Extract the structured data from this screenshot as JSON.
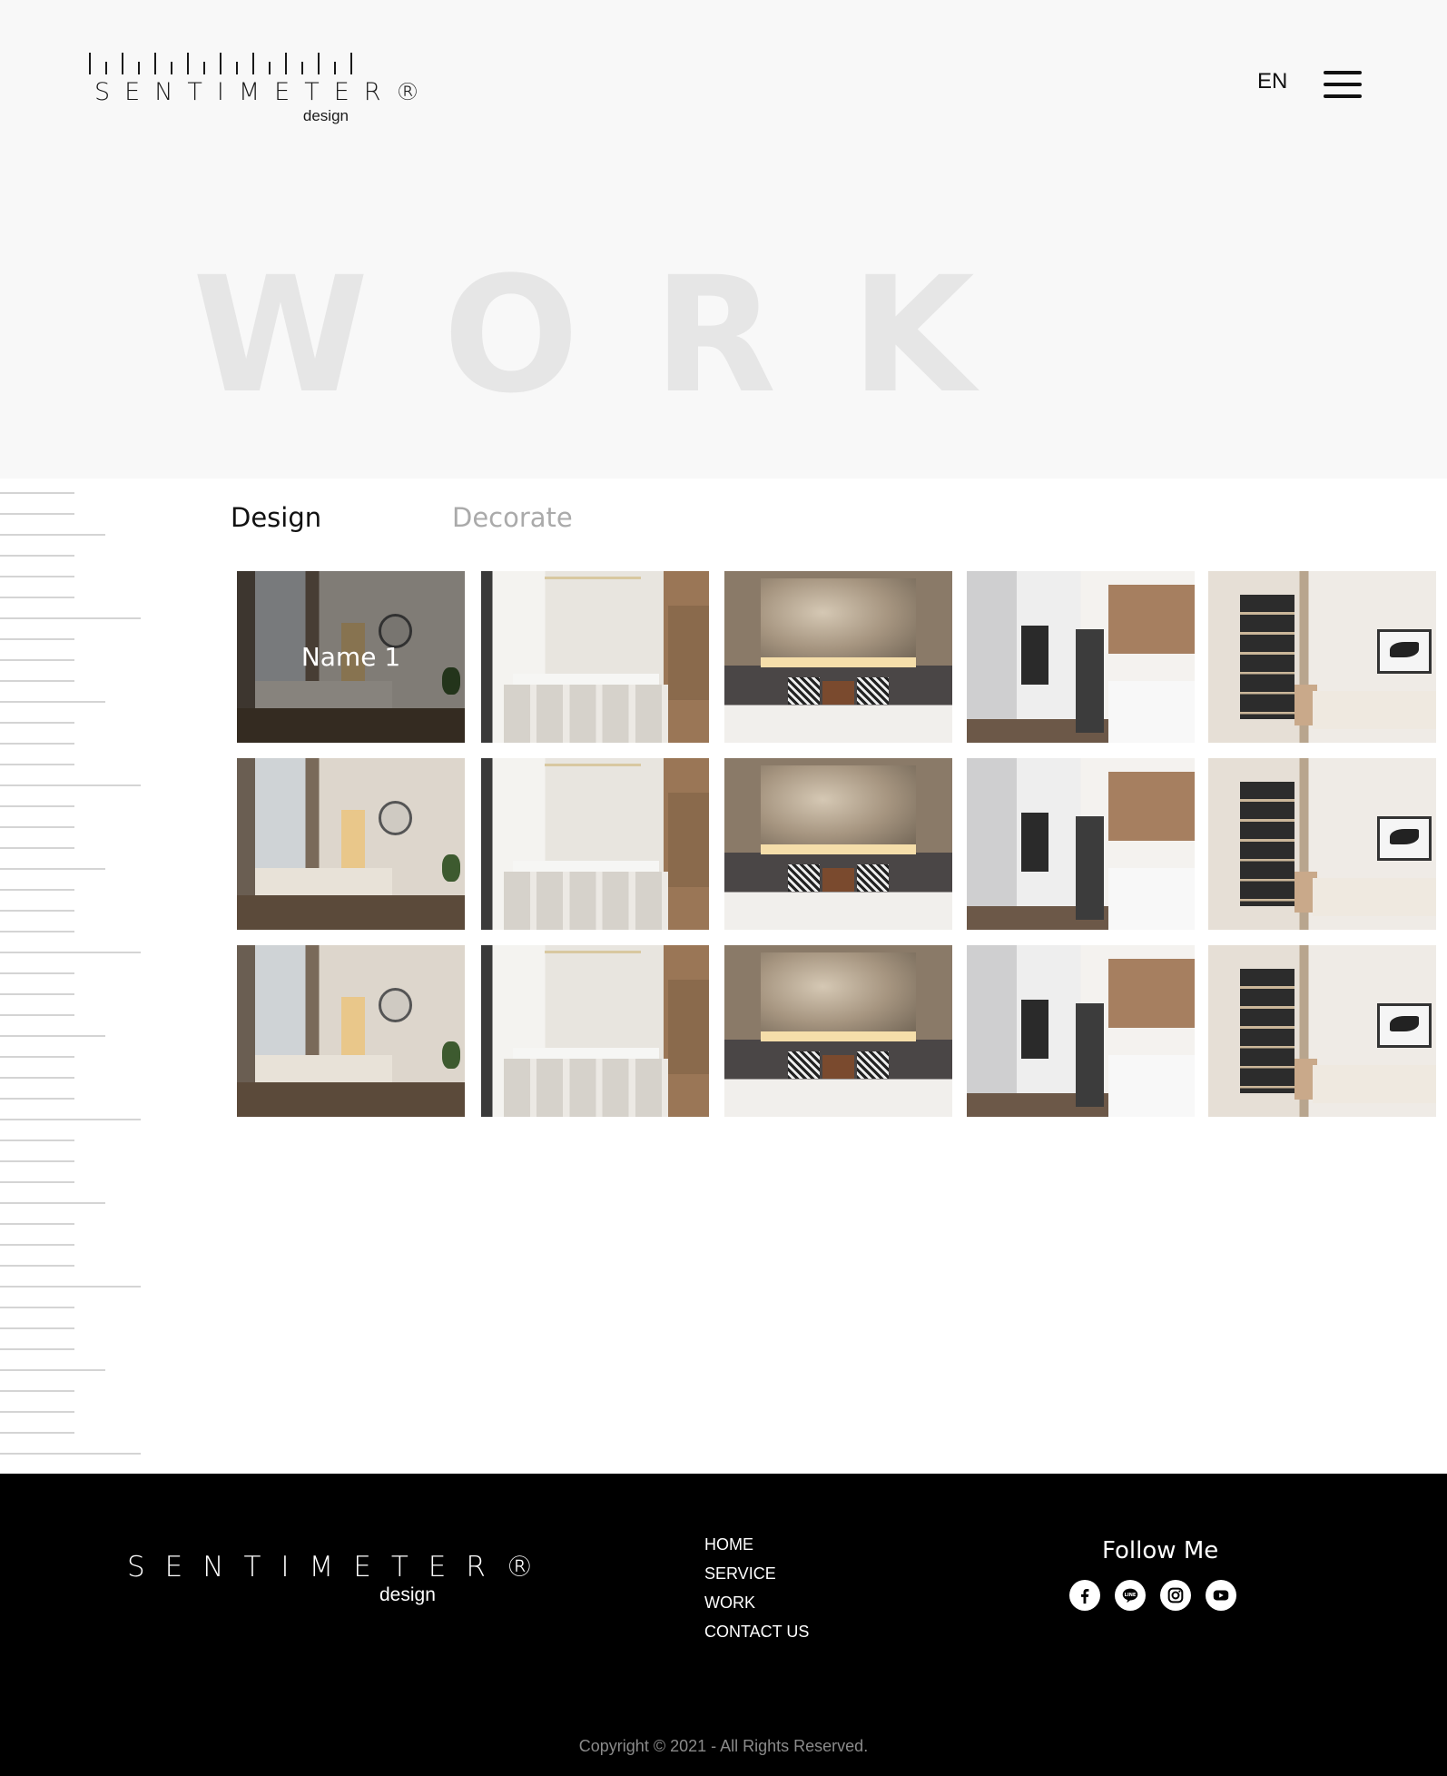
{
  "header": {
    "brand": "SENTIMETER®",
    "brand_sub": "design",
    "language": "EN"
  },
  "hero": {
    "title": "WORK"
  },
  "tabs": [
    {
      "label": "Design",
      "active": true
    },
    {
      "label": "Decorate",
      "active": false
    }
  ],
  "gallery": {
    "hover_caption": "Name 1"
  },
  "footer": {
    "brand": "SENTIMETER®",
    "brand_sub": "design",
    "nav": [
      "HOME",
      "SERVICE",
      "WORK",
      "CONTACT US"
    ],
    "follow_label": "Follow Me",
    "social_icons": [
      "facebook-icon",
      "line-icon",
      "instagram-icon",
      "youtube-icon"
    ],
    "copyright": "Copyright © 2021 - All Rights Reserved."
  },
  "colors": {
    "hero_bg": "#f8f8f8",
    "hero_title": "#e6e6e6",
    "tab_active": "#111111",
    "tab_inactive": "#aaaaaa",
    "footer_bg": "#000000"
  }
}
